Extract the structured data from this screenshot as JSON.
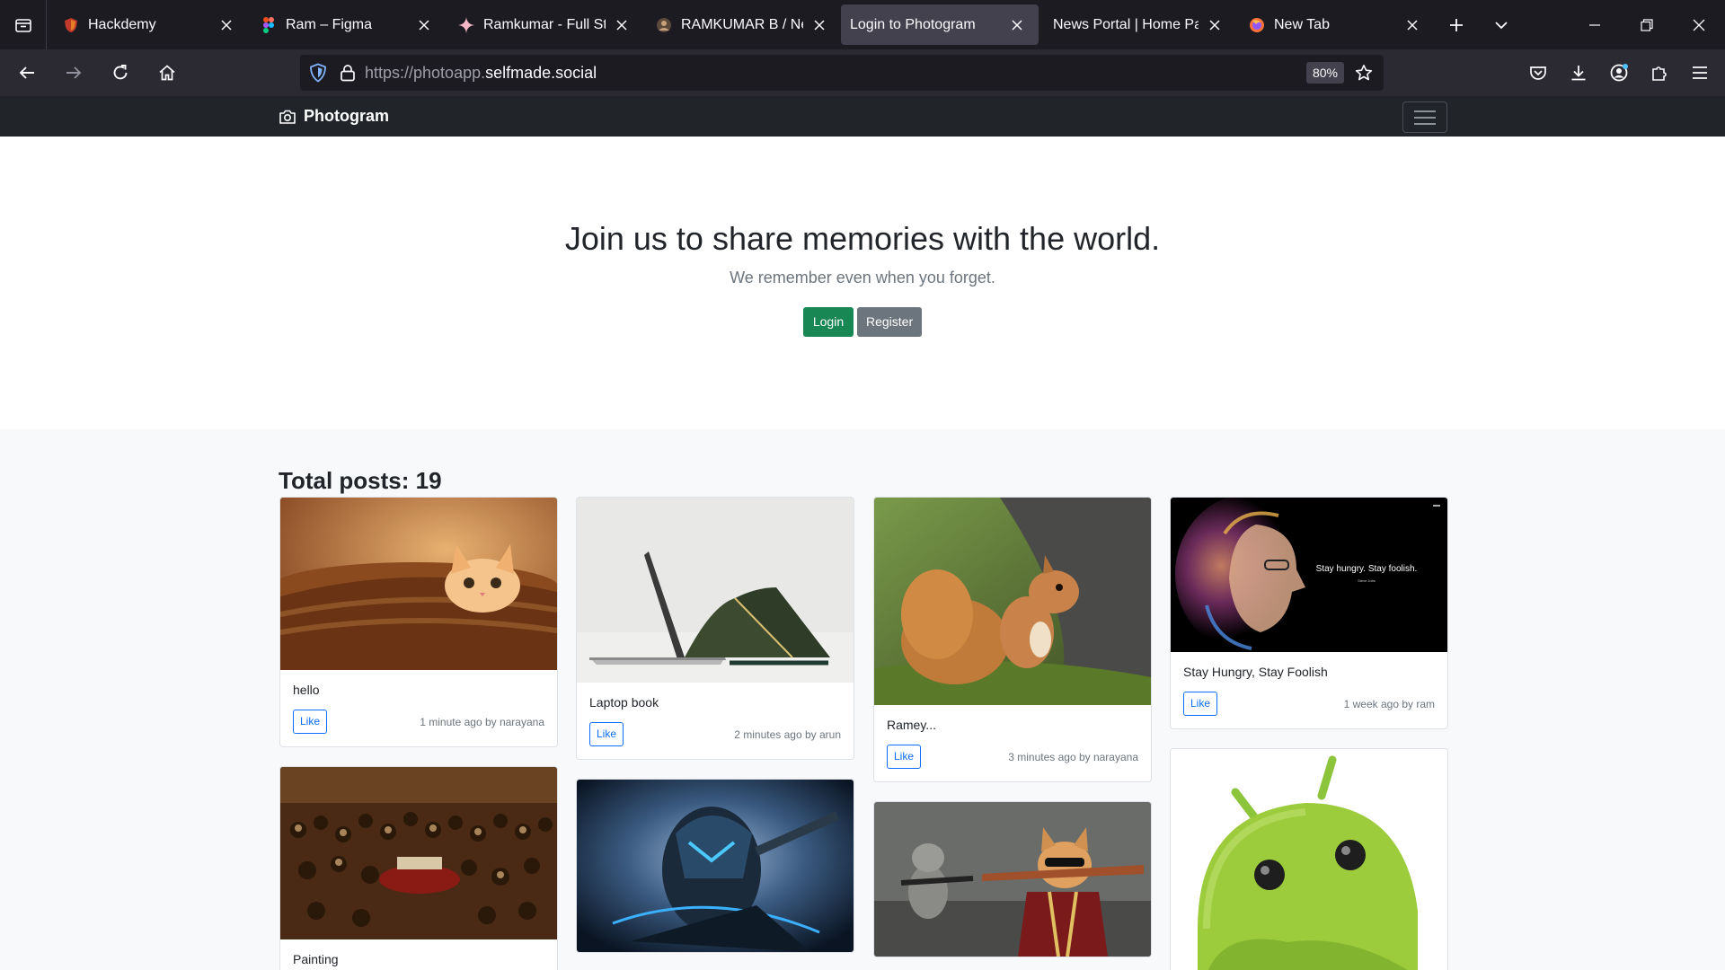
{
  "browser": {
    "tabs": [
      {
        "title": "Hackdemy",
        "icon": "shield-favicon",
        "active": false
      },
      {
        "title": "Ram – Figma",
        "icon": "figma-favicon",
        "active": false
      },
      {
        "title": "Ramkumar - Full Stack",
        "icon": "sparkle-favicon",
        "active": false
      },
      {
        "title": "RAMKUMAR B / News",
        "icon": "avatar-favicon",
        "active": false
      },
      {
        "title": "Login to Photogram",
        "icon": "",
        "active": true
      },
      {
        "title": "News Portal | Home Page",
        "icon": "",
        "active": false
      },
      {
        "title": "New Tab",
        "icon": "firefox-favicon",
        "active": false
      }
    ],
    "url_prefix": "https://photoapp.",
    "url_host": "selfmade.social",
    "zoom": "80%"
  },
  "app": {
    "brand": "Photogram",
    "hero_title": "Join us to share memories with the world.",
    "hero_lead": "We remember even when you forget.",
    "login_label": "Login",
    "register_label": "Register",
    "total_posts": "Total posts: 19",
    "like_label": "Like",
    "posts": [
      {
        "caption": "hello",
        "meta": "1 minute ago by narayana",
        "image": "kitten-in-basket"
      },
      {
        "caption": "Laptop book",
        "meta": "2 minutes ago by arun",
        "image": "laptop"
      },
      {
        "caption": "Ramey...",
        "meta": "3 minutes ago by narayana",
        "image": "squirrel"
      },
      {
        "caption": "Stay Hungry, Stay Foolish",
        "meta": "1 week ago by ram",
        "image": "steve-jobs-poster",
        "image_text": "Stay hungry. Stay foolish.",
        "image_subtext": "Steve Jobs"
      },
      {
        "caption": "Painting",
        "meta": "",
        "image": "crowd-painting"
      },
      {
        "caption": "",
        "meta": "",
        "image": "robot-wallpaper"
      },
      {
        "caption": "",
        "meta": "",
        "image": "cool-cat-bat"
      },
      {
        "caption": "",
        "meta": "",
        "image": "android-mascot"
      }
    ]
  }
}
